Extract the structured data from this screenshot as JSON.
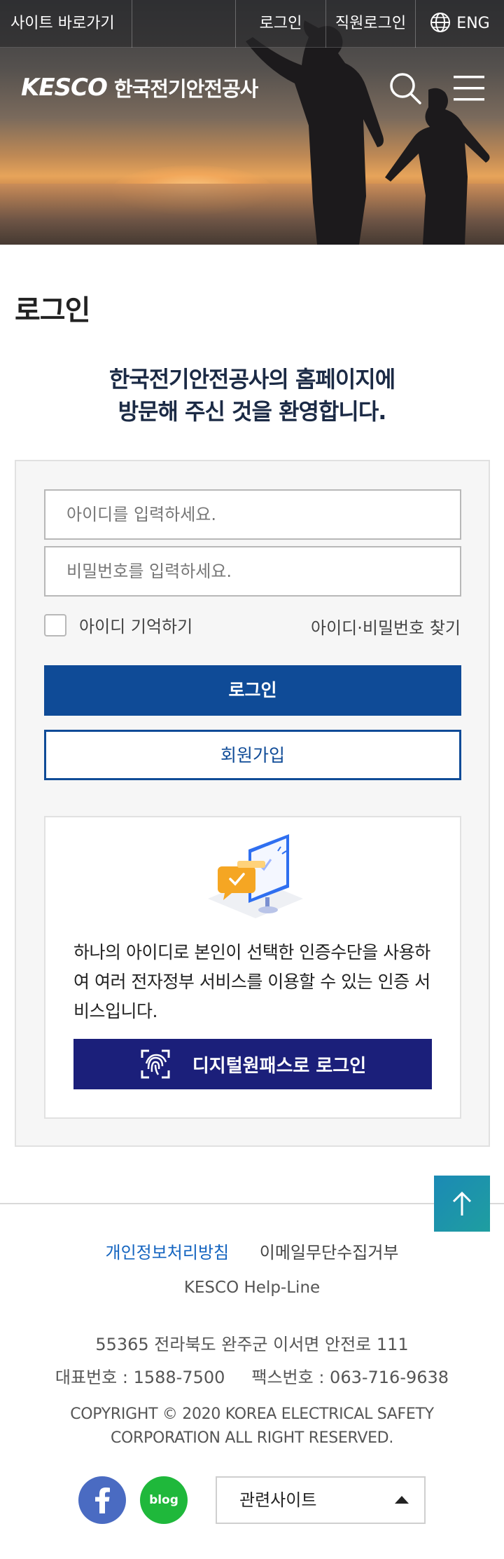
{
  "topbar": {
    "skip_label": "사이트 바로가기",
    "login_label": "로그인",
    "staff_login_label": "직원로그인",
    "eng_label": "ENG",
    "eng_icon": "globe-icon"
  },
  "header": {
    "logo_en": "KESCO",
    "logo_ko": "한국전기안전공사",
    "search_icon": "search-icon",
    "menu_icon": "hamburger-menu-icon"
  },
  "page": {
    "title": "로그인",
    "welcome_line1": "한국전기안전공사의 홈페이지에",
    "welcome_line2": "방문해 주신 것을 환영합니다."
  },
  "login_form": {
    "id_placeholder": "아이디를 입력하세요.",
    "id_value": "",
    "pw_placeholder": "비밀번호를 입력하세요.",
    "pw_value": "",
    "remember_label": "아이디 기억하기",
    "remember_checked": false,
    "find_label": "아이디·비밀번호 찾기",
    "login_button": "로그인",
    "join_button": "회원가입"
  },
  "digital_onepass": {
    "description": "하나의 아이디로 본인이 선택한 인증수단을 사용하여 여러 전자정부 서비스를 이용할 수 있는 인증 서비스입니다.",
    "button_label": "디지털원패스로 로그인",
    "button_icon": "fingerprint-icon",
    "illustration_icon": "monitor-chat-icon"
  },
  "footer": {
    "privacy_label": "개인정보처리방침",
    "email_label": "이메일무단수집거부",
    "helpline_label": "KESCO Help-Line",
    "address": "55365 전라북도 완주군 이서면 안전로 111",
    "tel": "대표번호 : 1588-7500",
    "fax": "팩스번호 : 063-716-9638",
    "copyright_line1": "COPYRIGHT © 2020 KOREA ELECTRICAL SAFETY",
    "copyright_line2": "CORPORATION ALL RIGHT RESERVED.",
    "facebook_icon": "facebook-icon",
    "blog_label": "blog",
    "related_sites_label": "관련사이트",
    "to_top_icon": "arrow-up-icon"
  },
  "colors": {
    "primary": "#0f4b97",
    "onepass": "#1b1f7a",
    "link": "#1565c0",
    "facebook": "#4a6bc2",
    "blog": "#1fb83b",
    "to_top": "#1b8ab5"
  }
}
